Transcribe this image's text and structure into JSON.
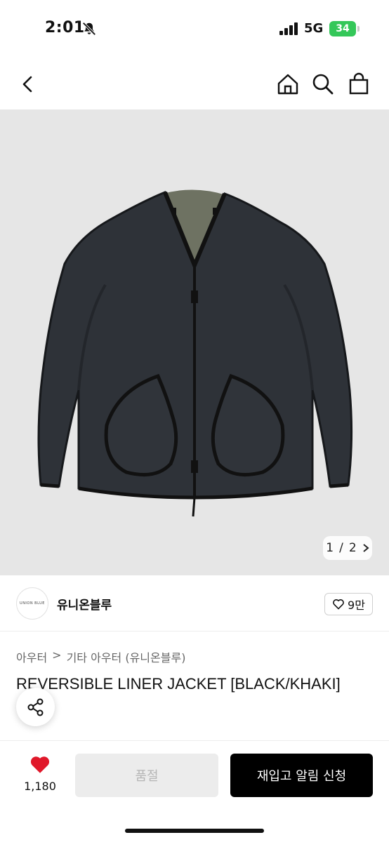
{
  "status_bar": {
    "time": "2:01",
    "network": "5G",
    "battery": "34"
  },
  "icons": {
    "back": "chevron-left-icon",
    "home": "home-icon",
    "search": "search-icon",
    "bag": "shopping-bag-icon",
    "share": "share-icon",
    "heart": "heart-icon"
  },
  "gallery": {
    "current": "1",
    "separator": "/",
    "total": "2"
  },
  "brand": {
    "logo_text": "UNION BLUE",
    "name": "유니온블루",
    "likes": "9만"
  },
  "breadcrumb": {
    "category": "아우터",
    "separator": ">",
    "subcategory": "기타 아우터 (유니온블루)"
  },
  "product": {
    "title": "REVERSIBLE LINER JACKET [BLACK/KHAKI]"
  },
  "bottom": {
    "wish_count": "1,180",
    "soldout_label": "품절",
    "restock_label": "재입고 알림 신청"
  },
  "colors": {
    "accent": "#e0182a",
    "battery": "#34c759",
    "jacket": "#2e3238",
    "lining": "#6e7262",
    "background": "#e6e6e6"
  }
}
